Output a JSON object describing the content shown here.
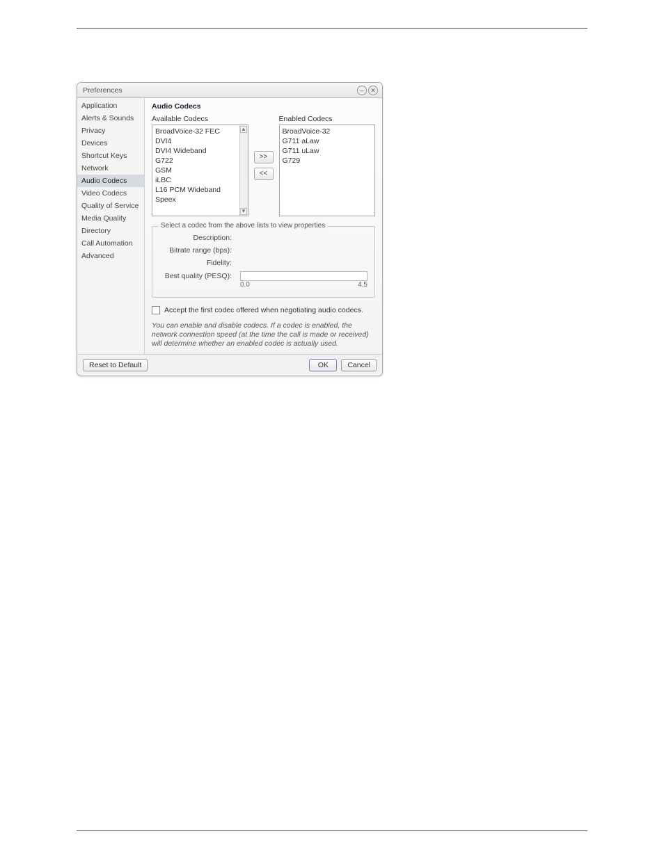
{
  "window": {
    "title": "Preferences"
  },
  "sidebar": {
    "items": [
      {
        "label": "Application"
      },
      {
        "label": "Alerts & Sounds"
      },
      {
        "label": "Privacy"
      },
      {
        "label": "Devices"
      },
      {
        "label": "Shortcut Keys"
      },
      {
        "label": "Network"
      },
      {
        "label": "Audio Codecs",
        "selected": true
      },
      {
        "label": "Video Codecs"
      },
      {
        "label": "Quality of Service"
      },
      {
        "label": "Media Quality"
      },
      {
        "label": "Directory"
      },
      {
        "label": "Call Automation"
      },
      {
        "label": "Advanced"
      }
    ]
  },
  "content": {
    "section_title": "Audio Codecs",
    "available": {
      "label": "Available Codecs",
      "items": [
        "BroadVoice-32 FEC",
        "DVI4",
        "DVI4 Wideband",
        "G722",
        "GSM",
        "iLBC",
        "L16 PCM Wideband",
        "Speex"
      ]
    },
    "enabled": {
      "label": "Enabled Codecs",
      "items": [
        "BroadVoice-32",
        "G711 aLaw",
        "G711 uLaw",
        "G729"
      ]
    },
    "move_right": ">>",
    "move_left": "<<",
    "fieldset": {
      "legend": "Select a codec from the above lists to view properties",
      "description_label": "Description:",
      "bitrate_label": "Bitrate range (bps):",
      "fidelity_label": "Fidelity:",
      "pesq_label": "Best quality (PESQ):",
      "pesq_min": "0.0",
      "pesq_max": "4.5"
    },
    "checkbox_label": "Accept the first codec offered when negotiating audio codecs.",
    "note_text": "You can enable and disable codecs. If a codec is enabled, the network connection speed (at the time the call is made or received) will determine whether an enabled codec is actually used."
  },
  "footer": {
    "reset": "Reset to Default",
    "ok": "OK",
    "cancel": "Cancel"
  }
}
